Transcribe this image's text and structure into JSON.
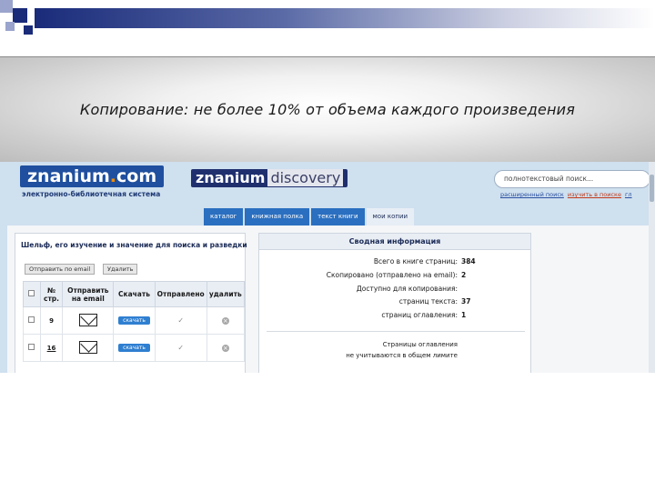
{
  "heading": "Копирование: не более 10% от объема  каждого произведения",
  "site": {
    "logo_main_part1": "znanium",
    "logo_main_dot": ".",
    "logo_main_part2": "com",
    "logo_subtitle": "электронно-библиотечная система",
    "logo_discovery_part1": "znanium",
    "logo_discovery_part2": "discovery",
    "search_placeholder": "полнотекстовый поиск...",
    "link_advanced": "расширенный поиск",
    "link_find": "изучить в поиске",
    "link_extra": "гл"
  },
  "nav": {
    "tabs": [
      "каталог",
      "книжная полка",
      "текст книги",
      "мои копии"
    ],
    "active_index": 3
  },
  "shelf": {
    "title": "Шельф, его изучение и значение для поиска и разведки",
    "send_button": "Отправить по email",
    "delete_button": "Удалить",
    "columns": [
      "",
      "№ стр.",
      "Отправить на email",
      "Скачать",
      "Отправлено",
      "удалить"
    ],
    "rows": [
      {
        "page": "9",
        "download_label": "скачать",
        "linked": false
      },
      {
        "page": "16",
        "download_label": "скачать",
        "linked": true
      }
    ]
  },
  "summary": {
    "title": "Сводная информация",
    "rows": [
      {
        "label": "Всего в книге страниц:",
        "value": "384"
      },
      {
        "label": "Скопировано (отправлено на email):",
        "value": "2"
      },
      {
        "label": "Доступно для копирования:",
        "value": ""
      },
      {
        "label": "страниц текста:",
        "value": "37"
      },
      {
        "label": "страниц оглавления:",
        "value": "1"
      }
    ],
    "note_line1": "Страницы оглавления",
    "note_line2": "не учитываются в общем лимите"
  },
  "colors": {
    "accent_blue": "#1f4f9e",
    "tab_blue": "#2a6fc0",
    "logo_dot_orange": "#f28a00"
  }
}
